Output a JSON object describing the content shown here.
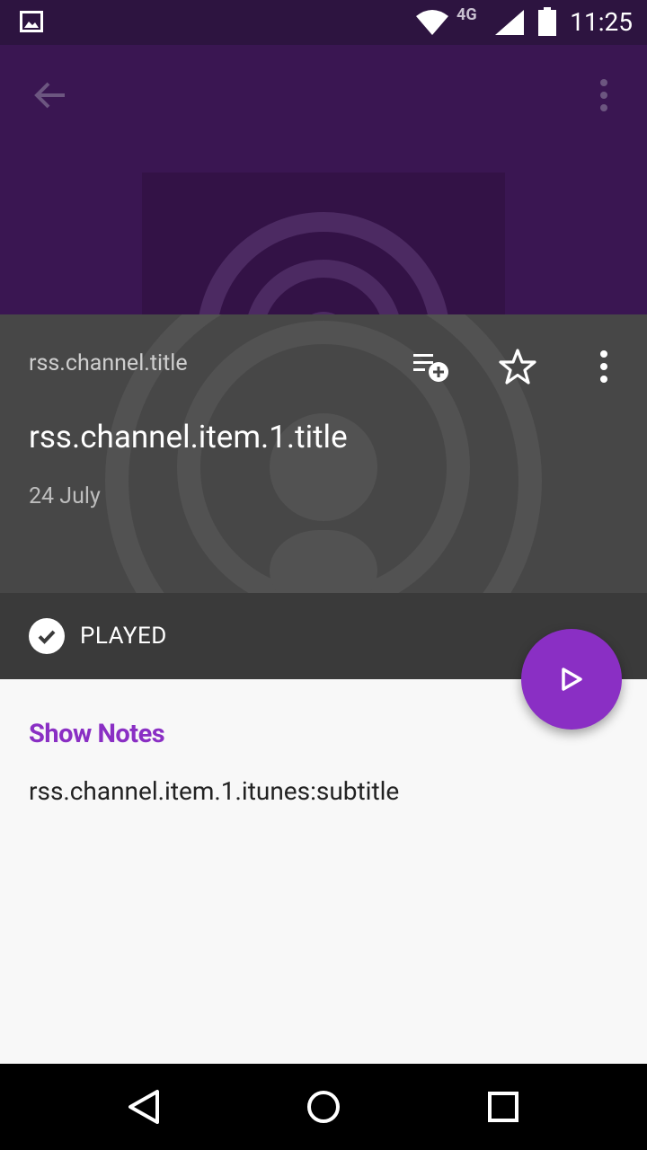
{
  "status_bar": {
    "time": "11:25",
    "network_label": "4G",
    "icons": [
      "image-notification-icon",
      "wifi-icon",
      "signal-icon",
      "battery-icon"
    ]
  },
  "app_bar": {
    "back_icon": "arrow-back-icon",
    "menu_icon": "more-vert-icon"
  },
  "episode": {
    "channel_title": "rss.channel.title",
    "title": "rss.channel.item.1.title",
    "date": "24 July",
    "actions": [
      "playlist-add-icon",
      "star-outline-icon",
      "more-vert-icon"
    ]
  },
  "played": {
    "label": "PLAYED",
    "icon": "check-circle-icon"
  },
  "fab": {
    "icon": "play-icon"
  },
  "show_notes": {
    "heading": "Show Notes",
    "body": "rss.channel.item.1.itunes:subtitle"
  },
  "nav_bar": {
    "icons": [
      "back-triangle-icon",
      "home-circle-icon",
      "recents-square-icon"
    ]
  },
  "colors": {
    "accent": "#8a2fc4",
    "header": "#3a1652",
    "status_bar": "#2d1440",
    "panel": "#474747",
    "played_strip": "#3a3a3a"
  }
}
